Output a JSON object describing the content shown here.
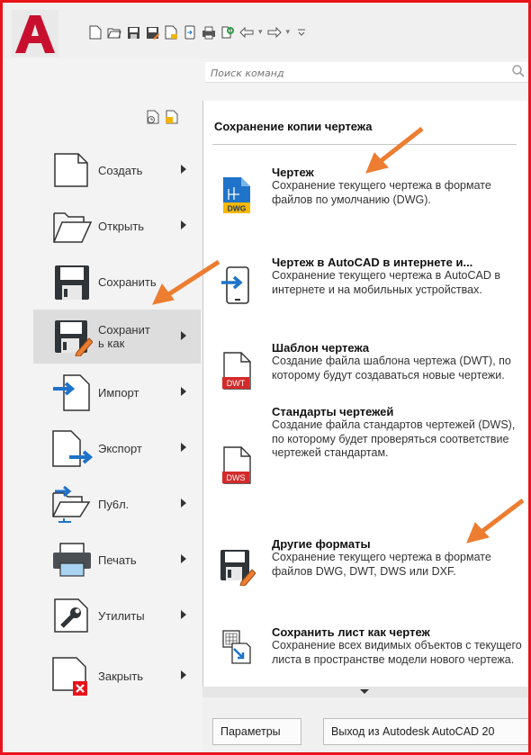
{
  "search": {
    "placeholder": "Поиск команд"
  },
  "left_menu": [
    {
      "id": "create",
      "label": "Создать",
      "icon": "blank-document-icon"
    },
    {
      "id": "open",
      "label": "Открыть",
      "icon": "open-folder-icon"
    },
    {
      "id": "save",
      "label": "Сохранить",
      "icon": "floppy-disk-icon"
    },
    {
      "id": "save-as",
      "label": "Сохранит ь как",
      "icon": "floppy-disk-pencil-icon",
      "active": true
    },
    {
      "id": "import",
      "label": "Импорт",
      "icon": "import-document-icon"
    },
    {
      "id": "export",
      "label": "Экспорт",
      "icon": "export-document-icon"
    },
    {
      "id": "publish",
      "label": "Пу6л.",
      "icon": "publish-folder-icon"
    },
    {
      "id": "print",
      "label": "Печать",
      "icon": "printer-icon"
    },
    {
      "id": "utilities",
      "label": "Утилиты",
      "icon": "wrench-icon"
    },
    {
      "id": "close",
      "label": "Закрыть",
      "icon": "close-document-icon"
    }
  ],
  "panel": {
    "title": "Сохранение копии чертежа",
    "options": [
      {
        "title": "Чертеж",
        "desc": "Сохранение текущего чертежа в формате файлов по умолчанию (DWG).",
        "icon": "dwg-file-icon",
        "badge": "DWG"
      },
      {
        "title": "Чертеж в AutoCAD в интернете и...",
        "desc": "Сохранение текущего чертежа в AutoCAD в интернете и на мобильных устройствах.",
        "icon": "mobile-save-icon"
      },
      {
        "title": "Шаблон чертежа",
        "desc": "Создание файла шаблона чертежа (DWT), по которому будут создаваться новые чертежи.",
        "icon": "dwt-file-icon",
        "badge": "DWT"
      },
      {
        "title": "Стандарты чертежей",
        "desc": "Создание файла стандартов чертежей (DWS), по которому будет проверяться соответствие чертежей стандартам.",
        "icon": "dws-file-icon",
        "badge": "DWS"
      },
      {
        "title": "Другие форматы",
        "desc": "Сохранение текущего чертежа в формате файлов DWG, DWT, DWS или DXF.",
        "icon": "floppy-disk-pencil-icon"
      },
      {
        "title": "Сохранить лист как чертеж",
        "desc": "Сохранение всех видимых объектов с текущего листа в пространстве модели нового чертежа.",
        "icon": "layout-to-drawing-icon"
      }
    ]
  },
  "footer": {
    "options_button": "Параметры",
    "exit_button": "Выход из Autodesk AutoCAD 20"
  },
  "colors": {
    "frame": "#e8141b",
    "autocad_red": "#c8102e",
    "annotation_arrow": "#ec7d31",
    "dwg_blue": "#1f73c9",
    "file_red": "#d42a2a"
  }
}
